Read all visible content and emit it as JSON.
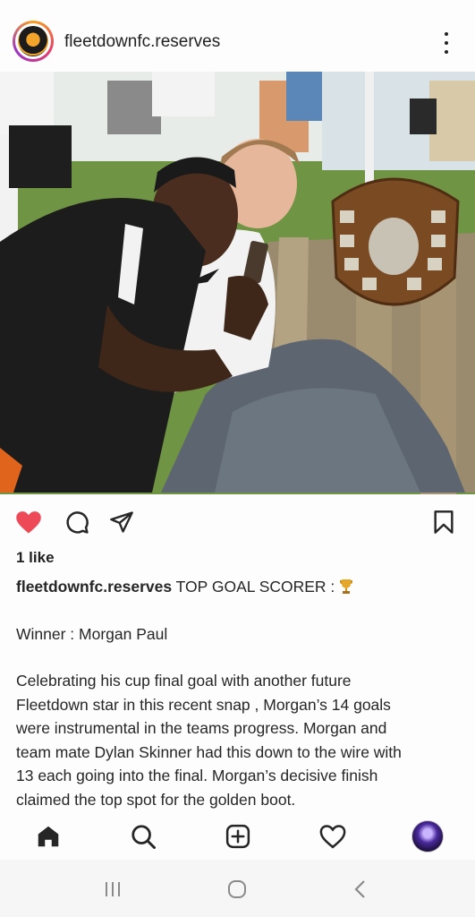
{
  "header": {
    "username": "fleetdownfc.reserves",
    "avatar_icon": "club-crest",
    "more_icon": "more-vertical-icon"
  },
  "post": {
    "liked": true,
    "like_color": "#ed4956",
    "likes_text": "1 like",
    "caption": {
      "username": "fleetdownfc.reserves",
      "headline": "TOP GOAL SCORER :",
      "headline_emoji_icon": "trophy-icon",
      "winner_line": "Winner : Morgan Paul",
      "body_lines": [
        "Celebrating his cup final goal with another future",
        "Fleetdown star in this recent snap , Morgan’s 14 goals",
        "were instrumental in the teams progress. Morgan and",
        "team mate Dylan Skinner had this down to the wire with",
        "13 each going into the final. Morgan’s decisive finish",
        "claimed the top spot for the golden boot."
      ]
    }
  },
  "bottom_nav": [
    "home-icon",
    "search-icon",
    "add-post-icon",
    "activity-heart-icon",
    "profile-avatar"
  ],
  "system_nav": [
    "recent-apps-icon",
    "home-circle-icon",
    "back-chevron-icon"
  ]
}
